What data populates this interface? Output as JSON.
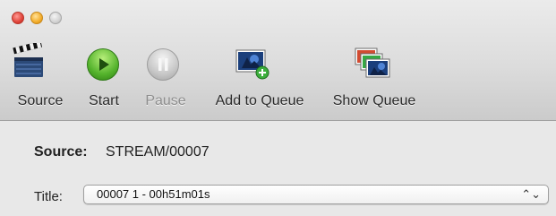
{
  "toolbar": {
    "source_label": "Source",
    "start_label": "Start",
    "pause_label": "Pause",
    "add_queue_label": "Add to Queue",
    "show_queue_label": "Show Queue"
  },
  "main": {
    "source_label": "Source:",
    "source_value": "STREAM/00007",
    "title_label": "Title:",
    "title_value": "00007 1 - 00h51m01s"
  },
  "icons": {
    "source": "clapperboard-icon",
    "start": "play-icon",
    "pause": "pause-icon",
    "add_queue": "add-to-queue-icon",
    "show_queue": "show-queue-icon"
  },
  "colors": {
    "start_green": "#54b32c",
    "close_red": "#e0443a",
    "minimize_yellow": "#f3ad2a"
  }
}
